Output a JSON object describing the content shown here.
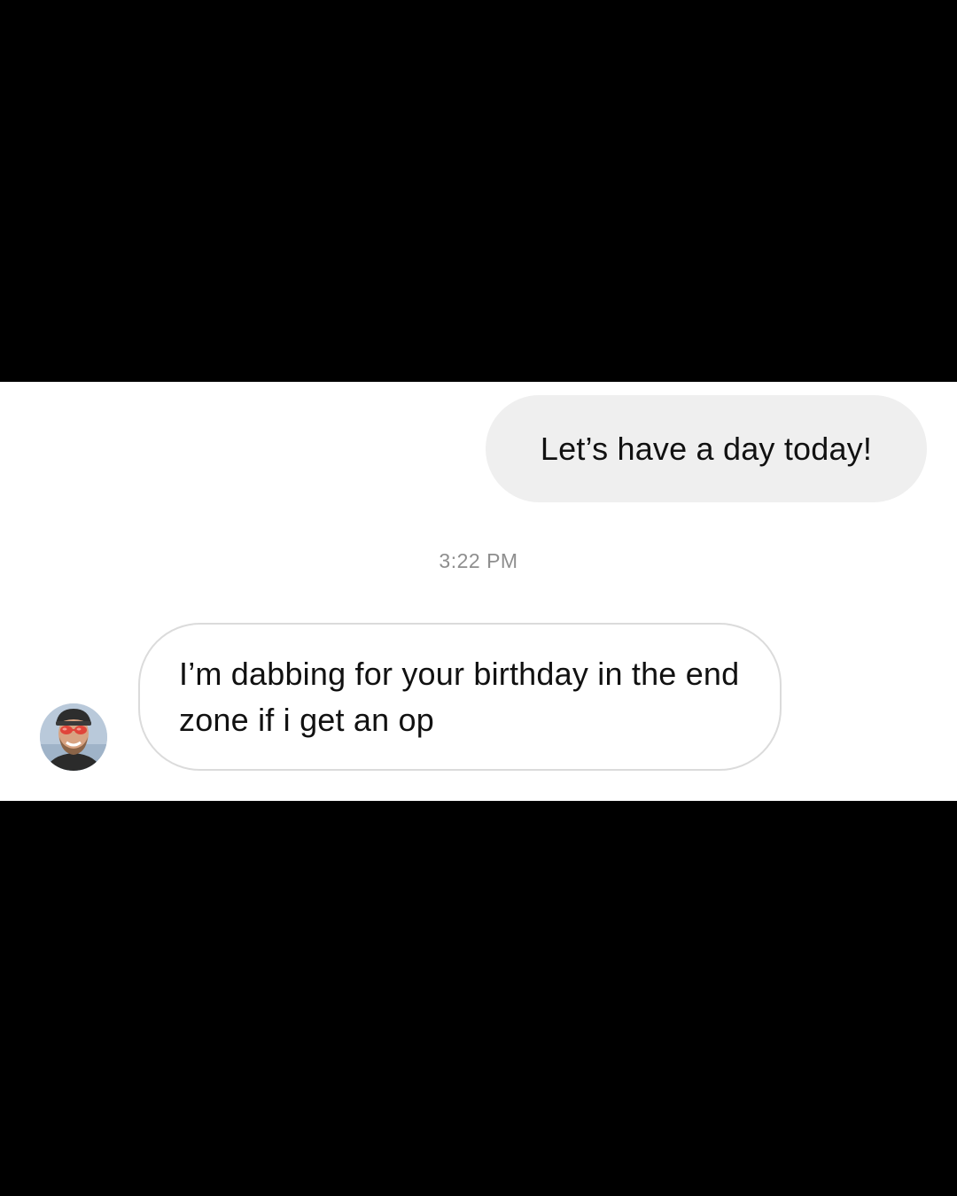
{
  "conversation": {
    "sent_message": {
      "text": "Let’s have a day today!"
    },
    "timestamp": "3:22 PM",
    "received_message": {
      "text": "I’m dabbing for your birthday in the end zone if i get an op",
      "avatar_icon": "user-avatar-photo"
    }
  },
  "colors": {
    "letterbox": "#000000",
    "panel_background": "#ffffff",
    "sent_bubble": "#efefef",
    "received_bubble_border": "#dbdbdb",
    "timestamp_text": "#8e8e8e",
    "message_text": "#111111"
  }
}
